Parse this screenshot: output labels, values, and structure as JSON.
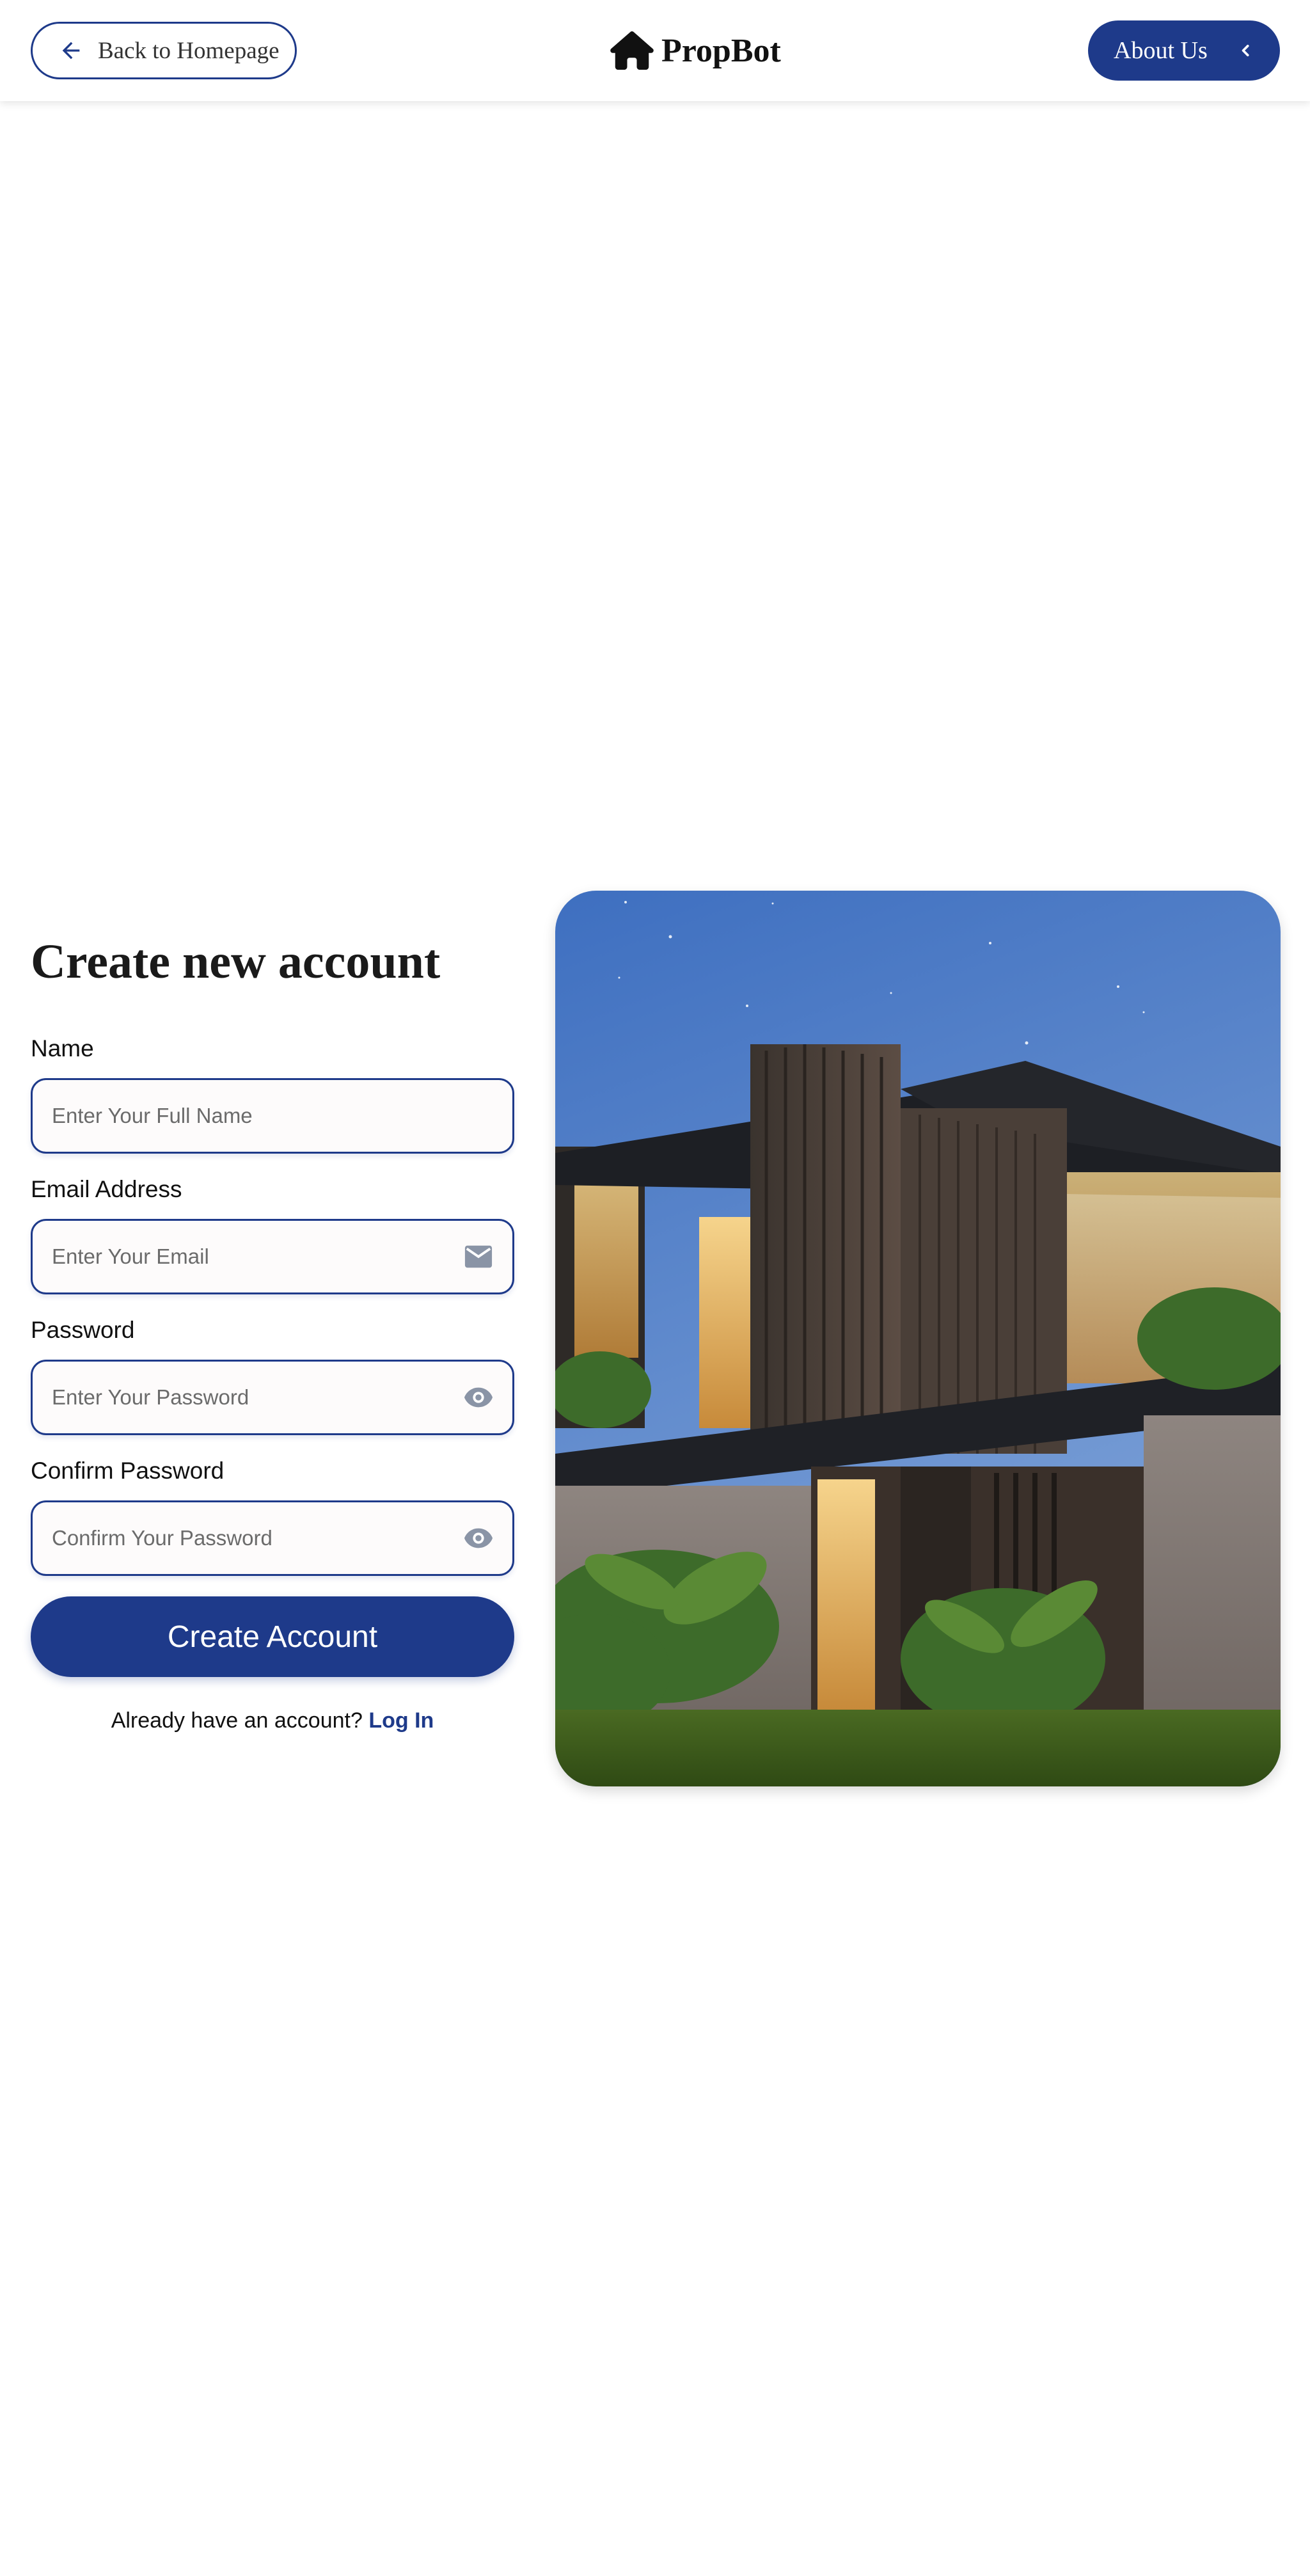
{
  "header": {
    "back_label": "Back to Homepage",
    "brand_name": "PropBot",
    "about_label": "About Us"
  },
  "form": {
    "title": "Create new account",
    "fields": [
      {
        "label": "Name",
        "placeholder": "Enter Your Full Name",
        "icon": "none"
      },
      {
        "label": "Email Address",
        "placeholder": "Enter Your Email",
        "icon": "mail-icon"
      },
      {
        "label": "Password",
        "placeholder": "Enter Your Password",
        "icon": "eye-icon"
      },
      {
        "label": "Confirm Password",
        "placeholder": "Confirm Your Password",
        "icon": "eye-icon"
      }
    ],
    "submit_label": "Create Account",
    "login_prompt": "Already have an account?",
    "login_link": "Log In"
  },
  "colors": {
    "accent": "#1e3a8a",
    "background": "#ffffff",
    "icon_gray": "#8a94a6"
  }
}
